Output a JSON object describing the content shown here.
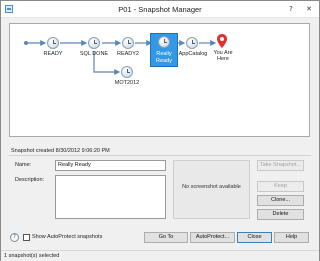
{
  "window": {
    "title": "P01 - Snapshot Manager",
    "help_glyph": "?",
    "close_glyph": "✕"
  },
  "snapshots": {
    "nodes": [
      {
        "label": "READY"
      },
      {
        "label": "SQL DONE"
      },
      {
        "label": "READY2"
      },
      {
        "label": "Really Ready",
        "selected": true
      },
      {
        "label": "AppCatalog"
      },
      {
        "label": "MOT2012"
      }
    ],
    "you_are_here": "You Are Here"
  },
  "details": {
    "created_text": "Snapshot created 8/30/2012 9:06:20 PM",
    "name_label": "Name:",
    "name_value": "Really Ready",
    "description_label": "Description:",
    "description_value": "",
    "screenshot_text": "No screenshot available"
  },
  "side_buttons": {
    "take_snapshot": "Take Snapshot...",
    "keep": "Keep",
    "clone": "Clone...",
    "delete": "Delete"
  },
  "bottom": {
    "help_icon_glyph": "?",
    "show_autoprotect_label": "Show AutoProtect snapshots",
    "show_autoprotect_checked": false,
    "go_to": "Go To",
    "autoprotect": "AutoProtect...",
    "close": "Close",
    "help": "Help"
  },
  "status_bar": {
    "text": "1 snapshot(s) selected"
  },
  "colors": {
    "selection": "#3398e6",
    "connector": "#5a86b8",
    "pin": "#e03030"
  }
}
